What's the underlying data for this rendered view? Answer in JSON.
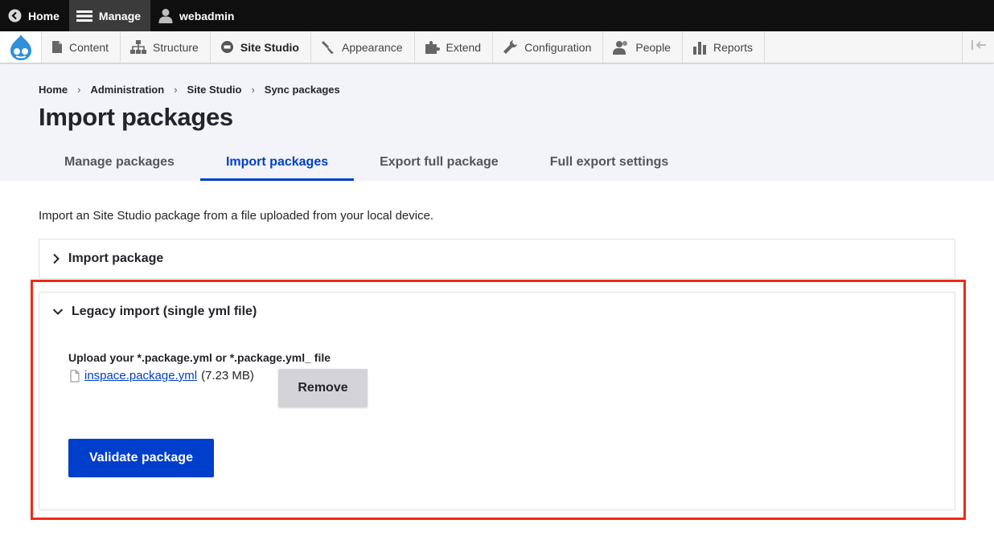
{
  "toolbar": {
    "home_label": "Home",
    "manage_label": "Manage",
    "user_label": "webadmin"
  },
  "tray": {
    "items": [
      {
        "label": "Content",
        "icon": "page-icon"
      },
      {
        "label": "Structure",
        "icon": "sitemap-icon"
      },
      {
        "label": "Site Studio",
        "icon": "sitestudio-icon"
      },
      {
        "label": "Appearance",
        "icon": "paintbrush-icon"
      },
      {
        "label": "Extend",
        "icon": "puzzle-icon"
      },
      {
        "label": "Configuration",
        "icon": "wrench-icon"
      },
      {
        "label": "People",
        "icon": "people-icon"
      },
      {
        "label": "Reports",
        "icon": "bar-chart-icon"
      }
    ],
    "active": "Site Studio"
  },
  "breadcrumb": [
    "Home",
    "Administration",
    "Site Studio",
    "Sync packages"
  ],
  "page_title": "Import packages",
  "tabs": [
    {
      "label": "Manage packages"
    },
    {
      "label": "Import packages"
    },
    {
      "label": "Export full package"
    },
    {
      "label": "Full export settings"
    }
  ],
  "active_tab": "Import packages",
  "intro_text": "Import an Site Studio package from a file uploaded from your local device.",
  "import_package": {
    "summary": "Import package",
    "expanded": false
  },
  "legacy_import": {
    "summary": "Legacy import (single yml file)",
    "expanded": true,
    "upload_label": "Upload your *.package.yml or *.package.yml_ file",
    "file_name": "inspace.package.yml",
    "file_size": "(7.23 MB)",
    "remove_label": "Remove",
    "validate_label": "Validate package"
  },
  "colors": {
    "accent": "#003ecc",
    "highlight": "#ee2a16",
    "toolbar": "#0f0f0f"
  }
}
